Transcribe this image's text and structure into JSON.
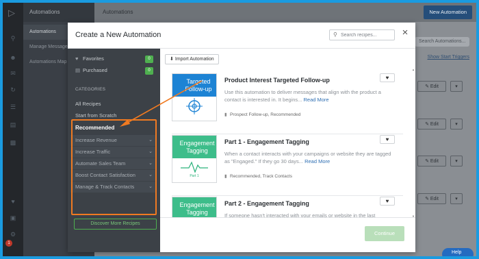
{
  "app": {
    "nav_title": "Automations",
    "top_title": "Automations",
    "new_button": "New Automation",
    "subnav_items": [
      "Automations",
      "Manage Messages",
      "Automations Map"
    ],
    "bg_search_placeholder": "Search Automations...",
    "show_start_triggers": "Show Start Triggers",
    "edit_label": "Edit",
    "help_label": "Help",
    "notification_count": "1"
  },
  "modal": {
    "title": "Create a New Automation",
    "search_placeholder": "Search recipes...",
    "close_icon": "×",
    "sidebar": {
      "favorites": {
        "label": "Favorites",
        "count": "0"
      },
      "purchased": {
        "label": "Purchased",
        "count": "0"
      },
      "categories_heading": "CATEGORIES",
      "all_recipes": "All Recipes",
      "start_from_scratch": "Start from Scratch",
      "recommended": "Recommended",
      "groups": [
        "Increase Revenue",
        "Increase Traffic",
        "Automate Sales Team",
        "Boost Contact Satisfaction",
        "Manage & Track Contacts"
      ],
      "discover": "Discover More Recipes"
    },
    "import_button": "Import Automation",
    "recipes": [
      {
        "thumb_title": "Targeted Follow-up",
        "thumb_color": "#1d83d4",
        "title": "Product Interest Targeted Follow-up",
        "desc": "Use this automation to deliver messages that align with the product a contact is interested in. It begins...",
        "more": "Read More",
        "tags": "Prospect Follow-up, Recommended"
      },
      {
        "thumb_title": "Engagement Tagging",
        "thumb_color": "#3dbd8a",
        "thumb_sub": "Part 1",
        "title": "Part 1 - Engagement Tagging",
        "desc": "When a contact interacts with your campaigns or website they are tagged as \"Engaged.\" If they go 30 days...",
        "more": "Read More",
        "tags": "Recommended, Track Contacts"
      },
      {
        "thumb_title": "Engagement Tagging",
        "thumb_color": "#3dbd8a",
        "title": "Part 2 - Engagement Tagging",
        "desc": "If someone hasn't interacted with your emails or website in the last",
        "more": "",
        "tags": ""
      }
    ],
    "continue_button": "Continue"
  },
  "colors": {
    "accent_green": "#4fb050",
    "highlight_orange": "#f07a21",
    "border_blue": "#1a9be0"
  }
}
